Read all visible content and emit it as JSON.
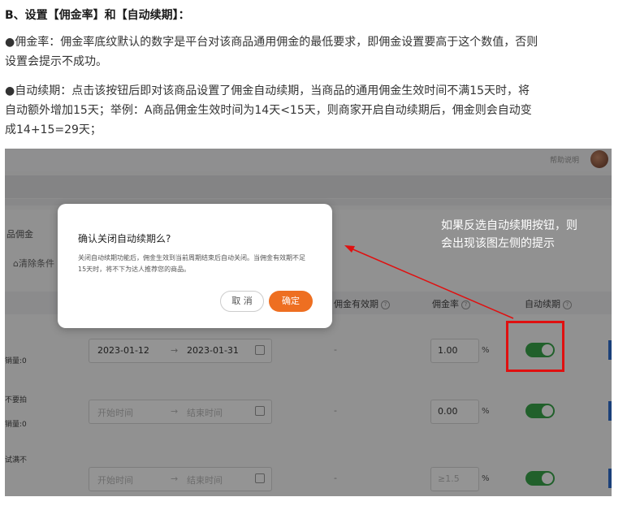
{
  "doc": {
    "heading": "B、设置【佣金率】和【自动续期】：",
    "para1_line1": "●佣金率：佣金率底纹默认的数字是平台对该商品通用佣金的最低要求，即佣金设置要高于这个数值，否则",
    "para1_line2": "设置会提示不成功。",
    "para2_line1": "●自动续期：点击该按钮后即对该商品设置了佣金自动续期，当商品的通用佣金生效时间不满15天时，将",
    "para2_line2": "自动额外增加15天；举例：A商品佣金生效时间为14天<15天，则商家开启自动续期后，佣金则会自动变",
    "para2_line3": "成14+15=29天；"
  },
  "screenshot": {
    "help_link": "帮助说明",
    "left_title": "品佣金",
    "clear_filter": "清除条件",
    "table_headers": {
      "validity": "佣金有效期",
      "rate": "佣金率",
      "auto_renew": "自动续期"
    },
    "rows": [
      {
        "label_top": "",
        "label_bottom": "销量:0",
        "date_start": "2023-01-12",
        "date_end": "2023-01-31",
        "validity": "-",
        "rate": "1.00",
        "rate_is_placeholder": false,
        "unit": "%",
        "auto_renew": true
      },
      {
        "label_top": "不要拍",
        "label_bottom": "销量:0",
        "date_start": "开始时间",
        "date_end": "结束时间",
        "validity": "-",
        "rate": "0.00",
        "rate_is_placeholder": false,
        "unit": "%",
        "auto_renew": true
      },
      {
        "label_top": "试满不",
        "label_bottom": "",
        "date_start": "开始时间",
        "date_end": "结束时间",
        "validity": "-",
        "rate": "≥1.5",
        "rate_is_placeholder": true,
        "unit": "%",
        "auto_renew": true
      }
    ],
    "date_separator": "→",
    "modal": {
      "title": "确认关闭自动续期么?",
      "body": "关闭自动续期功能后，佣金生效到当前周期结束后自动关闭。当佣金有效期不足15天时，将不下为达人推荐您的商品。",
      "cancel_label": "取 消",
      "ok_label": "确定"
    },
    "annotation_line1": "如果反选自动续期按钮，则",
    "annotation_line2": "会出现该图左侧的提示",
    "colors": {
      "toggle_on": "#3aa64a",
      "confirm_button": "#ee6f21",
      "highlight_box": "#e01010",
      "link_blue": "#2f6fd1"
    }
  }
}
